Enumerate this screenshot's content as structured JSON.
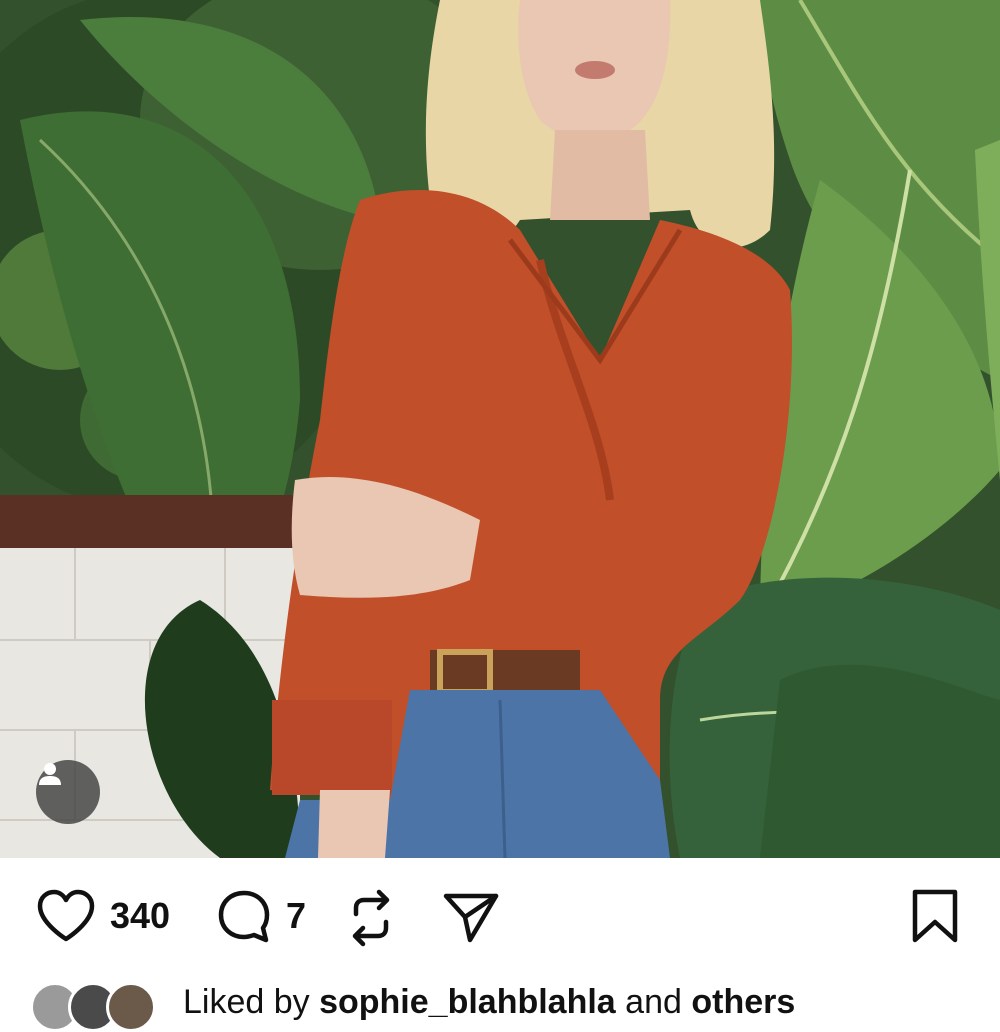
{
  "post": {
    "likes_count": "340",
    "comments_count": "7",
    "liked_by": {
      "prefix": "Liked by",
      "user": "sophie_blahblahla",
      "joiner": "and",
      "suffix": "others"
    }
  },
  "icons": {
    "like": "heart-icon",
    "comment": "comment-bubble-icon",
    "repost": "repost-icon",
    "share": "send-icon",
    "save": "bookmark-icon",
    "tag": "person-icon"
  },
  "colors": {
    "shirt": "#c04f2a",
    "jeans": "#4d74a6",
    "leaf_dark": "#2f5a2a",
    "leaf_light": "#6f9d4d",
    "wall": "#e9e7e2",
    "hair": "#e8d6a6",
    "skin": "#e9c7b2"
  }
}
